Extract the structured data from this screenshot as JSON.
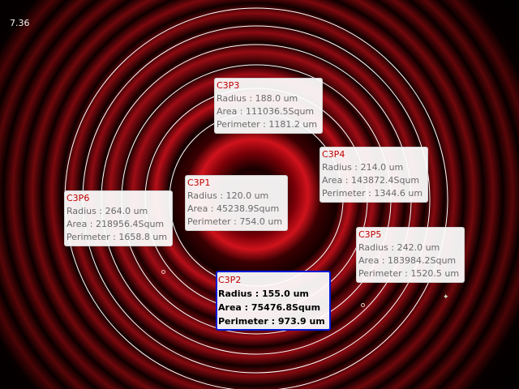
{
  "viewer": {
    "readout": "7.36"
  },
  "measurements": [
    {
      "id": "C3P3",
      "title": "C3P3",
      "radius": "Radius : 188.0 um",
      "area": "Area : 111036.5Squm",
      "perimeter": "Perimeter : 1181.2 um",
      "selected": false
    },
    {
      "id": "C3P4",
      "title": "C3P4",
      "radius": "Radius : 214.0 um",
      "area": "Area : 143872.4Squm",
      "perimeter": "Perimeter : 1344.6 um",
      "selected": false
    },
    {
      "id": "C3P1",
      "title": "C3P1",
      "radius": "Radius : 120.0 um",
      "area": "Area : 45238.9Squm",
      "perimeter": "Perimeter : 754.0 um",
      "selected": false
    },
    {
      "id": "C3P6",
      "title": "C3P6",
      "radius": "Radius : 264.0 um",
      "area": "Area : 218956.4Squm",
      "perimeter": "Perimeter : 1658.8 um",
      "selected": false
    },
    {
      "id": "C3P5",
      "title": "C3P5",
      "radius": "Radius : 242.0 um",
      "area": "Area : 183984.2Squm",
      "perimeter": "Perimeter : 1520.5 um",
      "selected": false
    },
    {
      "id": "C3P2",
      "title": "C3P2",
      "radius": "Radius : 155.0 um",
      "area": "Area : 75476.8Squm",
      "perimeter": "Perimeter : 973.9 um",
      "selected": true
    }
  ],
  "colors": {
    "ring_overlay": "#ffffff",
    "fringe": "#c0101a",
    "label_title": "#c00000",
    "selection_border": "#0018d8"
  }
}
